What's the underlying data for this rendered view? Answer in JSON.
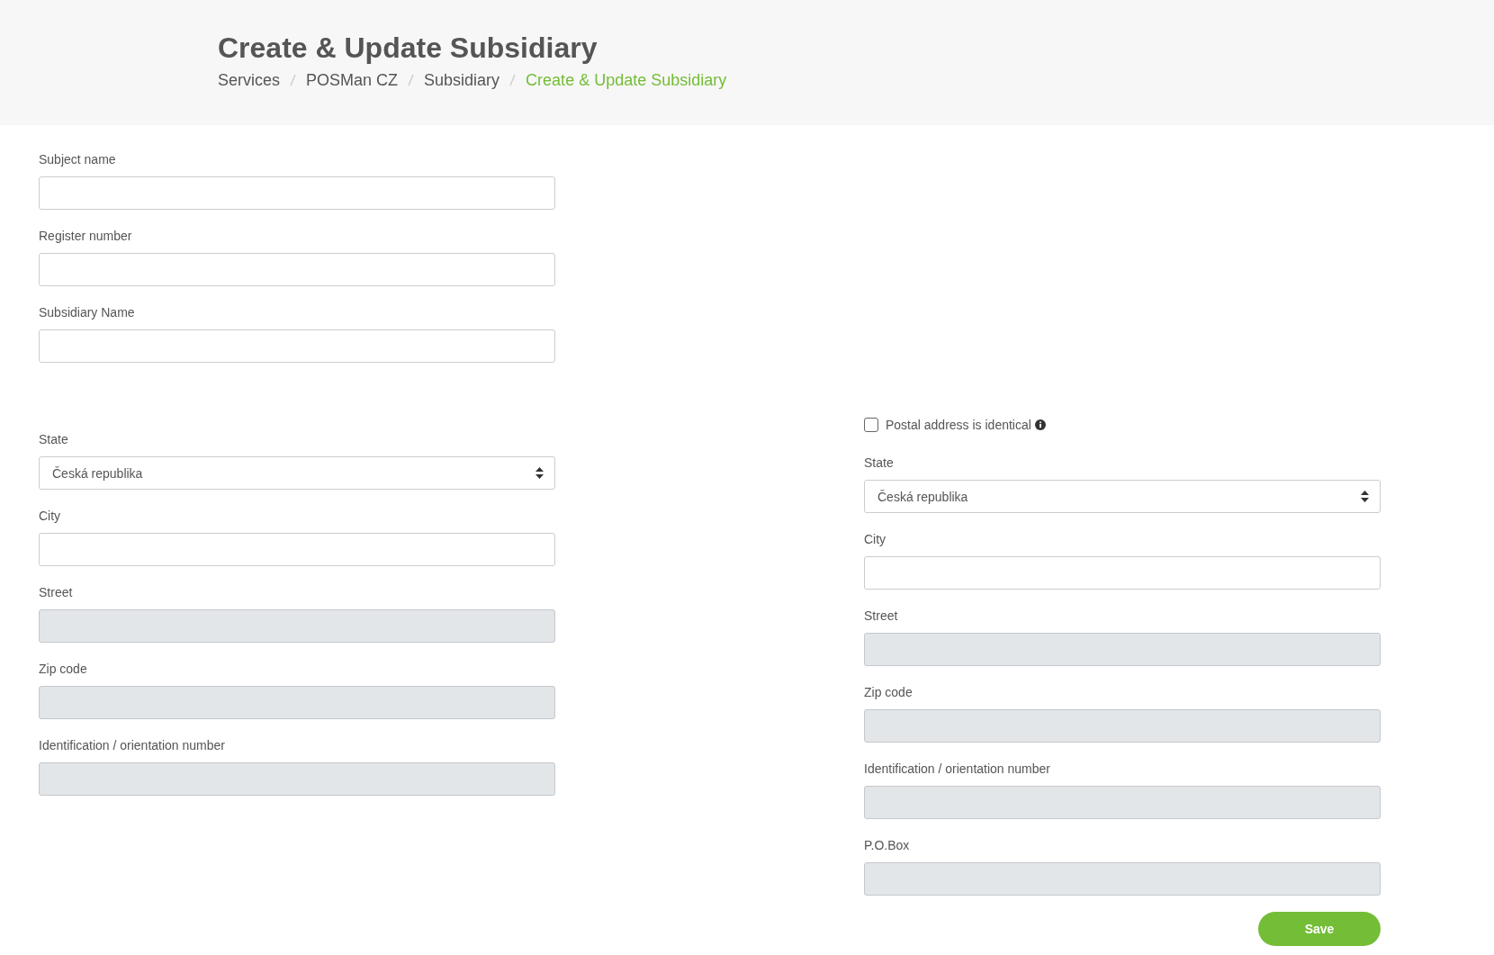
{
  "header": {
    "title": "Create & Update Subsidiary",
    "breadcrumb": [
      {
        "label": "Services",
        "current": false
      },
      {
        "label": "POSMan CZ",
        "current": false
      },
      {
        "label": "Subsidiary",
        "current": false
      },
      {
        "label": "Create & Update Subsidiary",
        "current": true
      }
    ]
  },
  "top_fields": [
    {
      "label": "Subject name",
      "kind": "input",
      "disabled": false
    },
    {
      "label": "Register number",
      "kind": "input",
      "disabled": false
    },
    {
      "label": "Subsidiary Name",
      "kind": "input",
      "disabled": false
    }
  ],
  "address": {
    "fields": [
      {
        "label": "State",
        "kind": "select",
        "value": "Česká republika",
        "disabled": false
      },
      {
        "label": "City",
        "kind": "input",
        "disabled": false
      },
      {
        "label": "Street",
        "kind": "input",
        "disabled": true
      },
      {
        "label": "Zip code",
        "kind": "input",
        "disabled": true
      },
      {
        "label": "Identification / orientation number",
        "kind": "input",
        "disabled": true
      }
    ]
  },
  "postal_address": {
    "identical": {
      "label": "Postal address is identical",
      "checked": false
    },
    "fields": [
      {
        "label": "State",
        "kind": "select",
        "value": "Česká republika",
        "disabled": false
      },
      {
        "label": "City",
        "kind": "input",
        "disabled": false
      },
      {
        "label": "Street",
        "kind": "input",
        "disabled": true
      },
      {
        "label": "Zip code",
        "kind": "input",
        "disabled": true
      },
      {
        "label": "Identification / orientation number",
        "kind": "input",
        "disabled": true
      },
      {
        "label": "P.O.Box",
        "kind": "input",
        "disabled": true
      }
    ]
  },
  "save_button": "Save"
}
